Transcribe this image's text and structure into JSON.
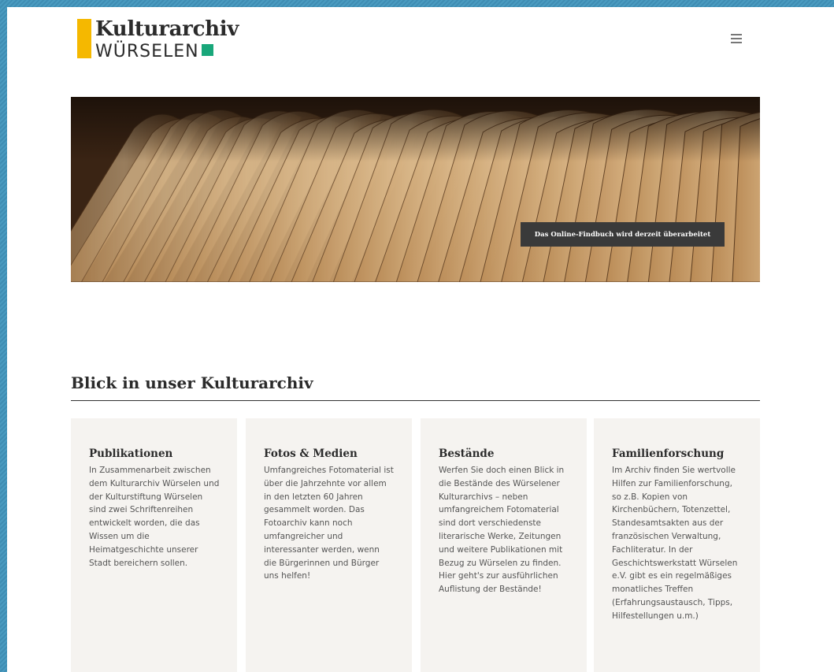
{
  "header": {
    "logo_title": "Kulturarchiv",
    "logo_subtitle": "WÜRSELEN",
    "menu_icon": "hamburger-menu-icon"
  },
  "hero": {
    "notice": "Das Online-Findbuch wird derzeit überarbeitet"
  },
  "section": {
    "title": "Blick in unser Kulturarchiv"
  },
  "cards": [
    {
      "title": "Publikationen",
      "text": "In Zusammenarbeit zwischen dem Kulturarchiv Würselen und der Kulturstiftung Würselen sind zwei Schriftenreihen entwickelt worden, die das Wissen um die Heimatgeschichte unserer Stadt bereichern sollen."
    },
    {
      "title": "Fotos & Medien",
      "text": "Umfangreiches Fotomaterial ist über die Jahrzehnte vor allem in den letzten 60 Jahren gesammelt worden. Das Fotoarchiv kann noch umfangreicher und interessanter werden, wenn die Bürgerinnen und Bürger uns helfen!"
    },
    {
      "title": "Bestände",
      "text": "Werfen Sie doch einen Blick in die Bestände des Würselener Kulturarchivs – neben umfangreichem Fotomaterial sind dort verschiedenste literarische Werke, Zeitungen und weitere Publikationen mit Bezug zu Würselen zu finden. Hier geht's zur ausführlichen Auflistung der Bestände!"
    },
    {
      "title": "Familienforschung",
      "text": "Im Archiv finden Sie wertvolle Hilfen zur Familienforschung, so z.B. Kopien von Kirchenbüchern, Totenzettel, Standesamtsakten aus der französischen Verwaltung, Fachliteratur. In der Geschichtswerkstatt Würselen e.V. gibt es ein regelmäßiges monatliches Treffen (Erfahrungsaustausch, Tipps, Hilfestellungen u.m.)"
    }
  ],
  "colors": {
    "logo_yellow": "#f5b800",
    "logo_green": "#19a77a",
    "card_bg": "#f5f3f0",
    "notice_bg": "#3a3a3a"
  }
}
